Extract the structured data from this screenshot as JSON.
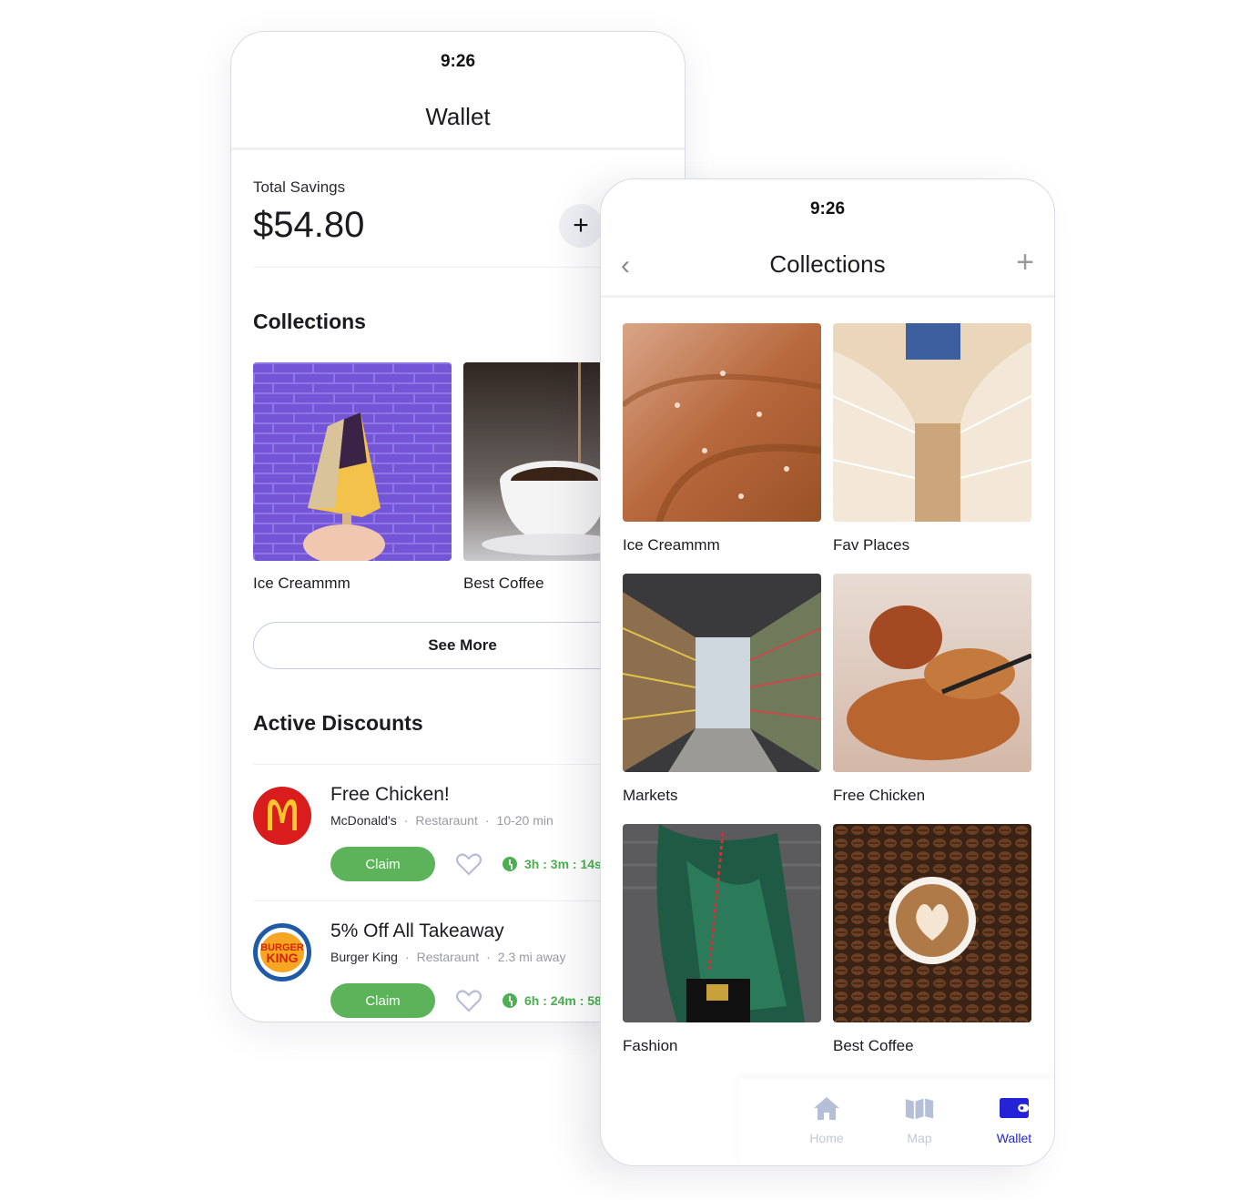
{
  "wallet_screen": {
    "status_time": "9:26",
    "title": "Wallet",
    "total_savings": {
      "label": "Total Savings",
      "value": "$54.80"
    },
    "add_icon": "plus-icon",
    "collections": {
      "title": "Collections",
      "items": [
        {
          "label": "Ice Creammm",
          "image": "popsicle-on-purple-wall"
        },
        {
          "label": "Best Coffee",
          "image": "coffee-pour"
        }
      ],
      "see_more": "See More"
    },
    "active_discounts": {
      "title": "Active Discounts",
      "items": [
        {
          "title": "Free Chicken!",
          "brand": "McDonald's",
          "category": "Restaraunt",
          "detail": "10-20 min",
          "claim": "Claim",
          "timer": "3h : 3m : 14s",
          "logo": "mcdonalds-logo"
        },
        {
          "title": "5% Off All Takeaway",
          "brand": "Burger King",
          "category": "Restaraunt",
          "detail": "2.3 mi away",
          "claim": "Claim",
          "timer": "6h : 24m : 58",
          "logo": "burger-king-logo"
        }
      ]
    }
  },
  "collections_screen": {
    "status_time": "9:26",
    "title": "Collections",
    "back_icon": "chevron-left-icon",
    "add_icon": "plus-icon",
    "items": [
      {
        "label": "Ice Creammm",
        "image": "chocolate-cream"
      },
      {
        "label": "Fav Places",
        "image": "shopping-mall"
      },
      {
        "label": "Markets",
        "image": "supermarket-aisle"
      },
      {
        "label": "Free Chicken",
        "image": "fried-chicken"
      },
      {
        "label": "Fashion",
        "image": "green-fur-coat"
      },
      {
        "label": "Best Coffee",
        "image": "latte-coffee-beans"
      }
    ],
    "tabbar": [
      {
        "label": "Home",
        "icon": "home-icon",
        "active": false
      },
      {
        "label": "Map",
        "icon": "map-icon",
        "active": false
      },
      {
        "label": "Wallet",
        "icon": "wallet-icon",
        "active": true
      }
    ]
  },
  "colors": {
    "accent_green": "#5cb35a",
    "active_tab": "#2424d6",
    "inactive_tab": "#b6bfd8"
  }
}
